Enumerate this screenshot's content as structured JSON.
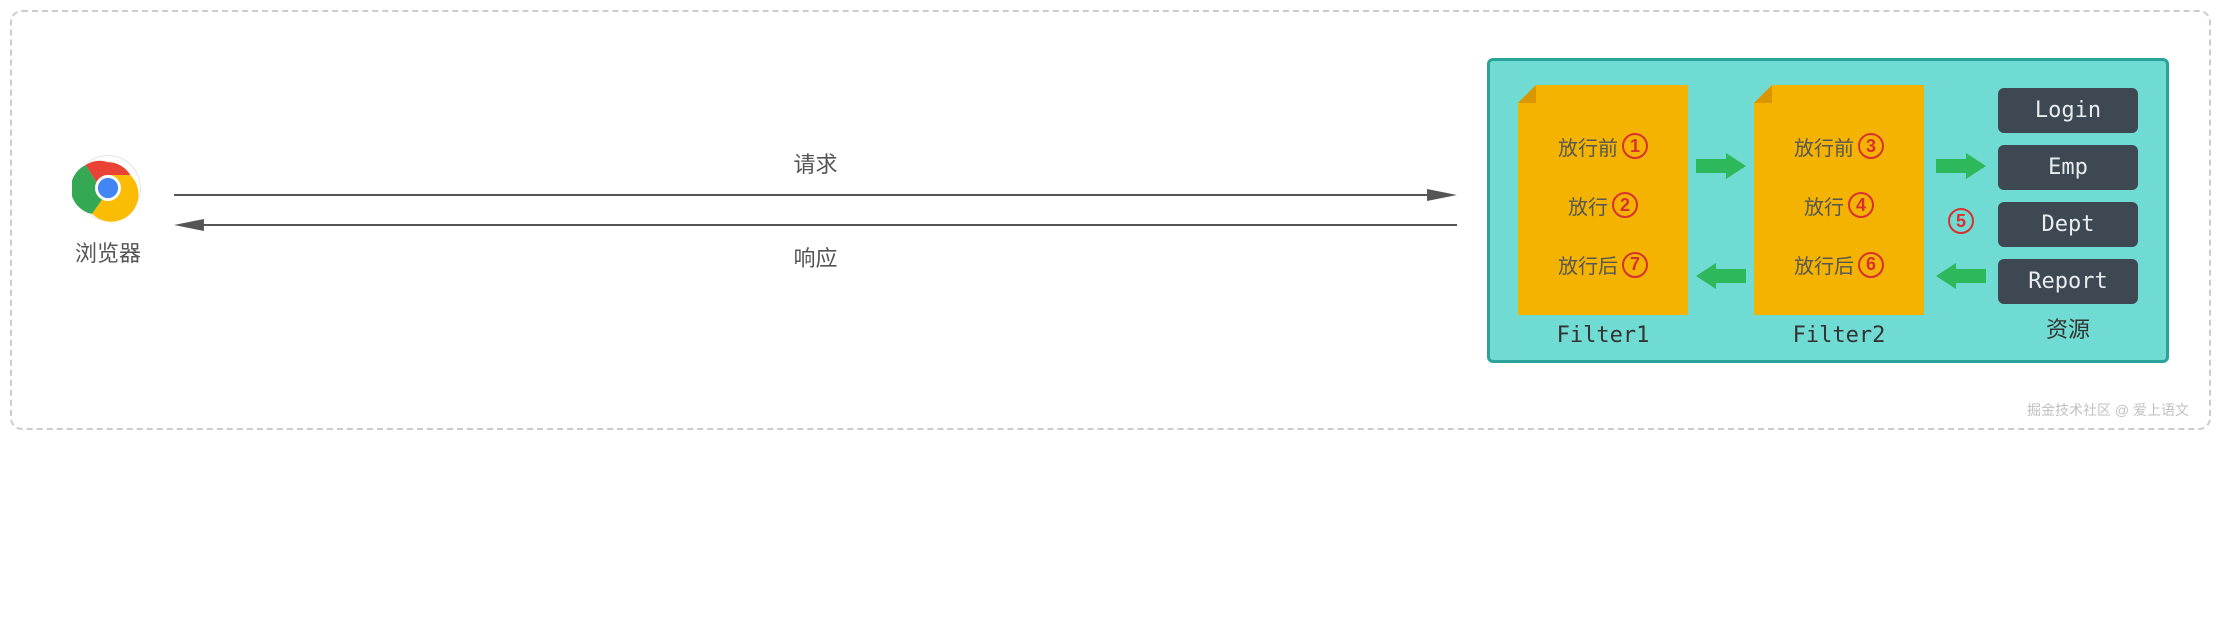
{
  "browser": {
    "label": "浏览器"
  },
  "arrows": {
    "request": "请求",
    "response": "响应"
  },
  "filters": [
    {
      "label": "Filter1",
      "lines": [
        {
          "text": "放行前",
          "num": "1"
        },
        {
          "text": "放行",
          "num": "2"
        },
        {
          "text": "放行后",
          "num": "7"
        }
      ]
    },
    {
      "label": "Filter2",
      "lines": [
        {
          "text": "放行前",
          "num": "3"
        },
        {
          "text": "放行",
          "num": "4"
        },
        {
          "text": "放行后",
          "num": "6"
        }
      ]
    }
  ],
  "middle_num": "5",
  "resources": {
    "label": "资源",
    "items": [
      "Login",
      "Emp",
      "Dept",
      "Report"
    ]
  },
  "watermark": "掘金技术社区 @ 爱上语文"
}
